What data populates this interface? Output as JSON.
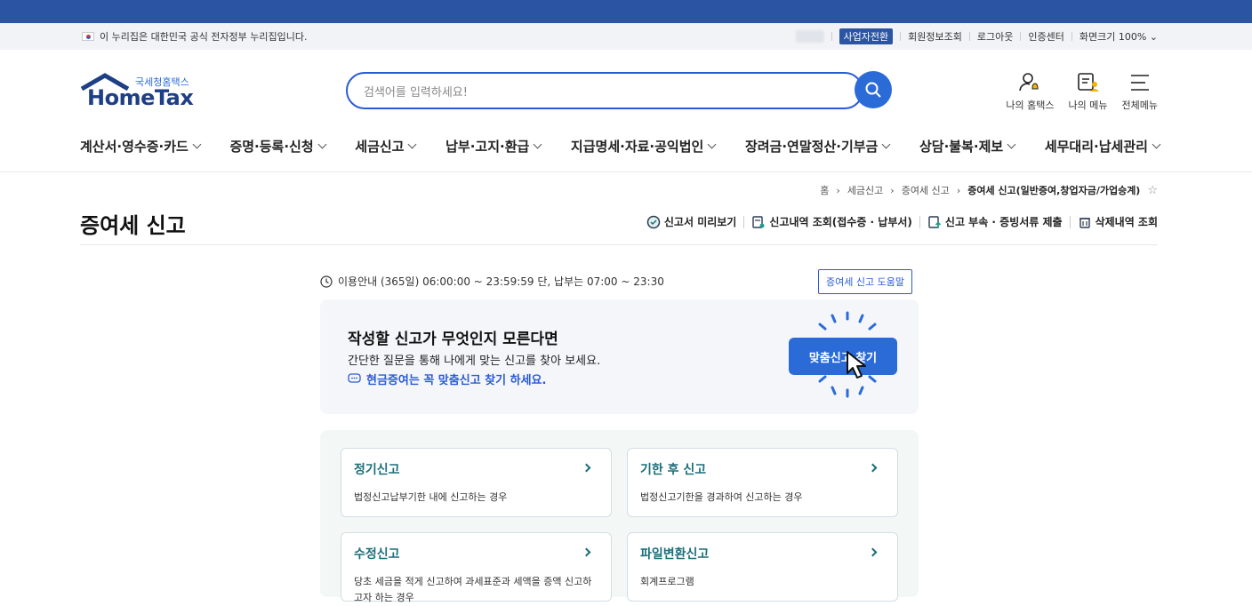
{
  "gov_banner": {
    "text": "이 누리집은 대한민국 공식 전자정부 누리집입니다."
  },
  "util": {
    "biz_switch": "사업자전환",
    "member_info": "회원정보조회",
    "logout": "로그아웃",
    "cert_center": "인증센터",
    "screen_size": "화면크기 100%"
  },
  "logo": {
    "sub": "국세청홈택스",
    "main": "HomeTax"
  },
  "search": {
    "placeholder": "검색어를 입력하세요!"
  },
  "header_icons": {
    "my_hometax": "나의 홈택스",
    "my_menu": "나의 메뉴",
    "all_menu": "전체메뉴"
  },
  "nav": [
    "계산서·영수증·카드",
    "증명·등록·신청",
    "세금신고",
    "납부·고지·환급",
    "지급명세·자료·공익법인",
    "장려금·연말정산·기부금",
    "상담·불복·제보",
    "세무대리·납세관리"
  ],
  "breadcrumb": [
    "홈",
    "세금신고",
    "증여세 신고",
    "증여세 신고(일반증여,창업자금/가업승계)"
  ],
  "page": {
    "title": "증여세 신고"
  },
  "tools": [
    "신고서 미리보기",
    "신고내역 조회(접수증 · 납부서)",
    "신고 부속 · 증빙서류 제출",
    "삭제내역 조회"
  ],
  "usage": {
    "text": "이용안내 (365일) 06:00:00 ~ 23:59:59 단, 납부는 07:00 ~ 23:30",
    "help": "증여세 신고 도움말"
  },
  "promo": {
    "heading": "작성할 신고가 무엇인지 모른다면",
    "desc": "간단한 질문을 통해 나에게 맞는 신고를 찾아 보세요.",
    "note": "현금증여는 꼭 맞춤신고 찾기 하세요.",
    "button": "맞춤신고 찾기"
  },
  "cards": [
    {
      "title": "정기신고",
      "desc": "법정신고납부기한 내에 신고하는 경우"
    },
    {
      "title": "기한 후 신고",
      "desc": "법정신고기한을 경과하여 신고하는 경우"
    },
    {
      "title": "수정신고",
      "desc": "당초 세금을 적게 신고하여 과세표준과 세액을 증액 신고하고자 하는 경우"
    },
    {
      "title": "파일변환신고",
      "desc": "회계프로그램"
    }
  ],
  "colors": {
    "primary": "#2a6bd8",
    "top_bar": "#2b55a3",
    "card_title": "#1b6e7a"
  }
}
